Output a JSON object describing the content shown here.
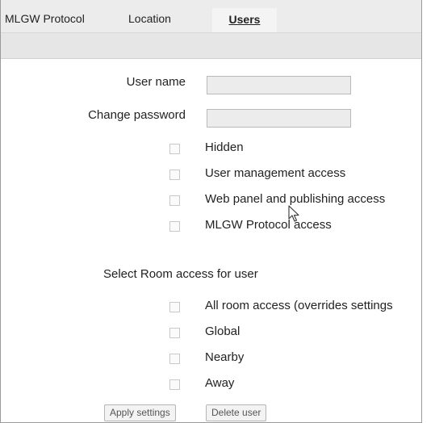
{
  "tabs": [
    {
      "label": "MLGW Protocol",
      "active": false
    },
    {
      "label": "Location",
      "active": false
    },
    {
      "label": "Users",
      "active": true
    }
  ],
  "form": {
    "user_name_label": "User name",
    "user_name_value": "",
    "change_password_label": "Change password",
    "change_password_value": ""
  },
  "permissions": [
    {
      "label": "Hidden",
      "checked": false
    },
    {
      "label": "User management access",
      "checked": false
    },
    {
      "label": "Web panel and publishing access",
      "checked": false
    },
    {
      "label": "MLGW Protocol access",
      "checked": false
    }
  ],
  "room_access": {
    "title": "Select Room access for user",
    "options": [
      {
        "label": "All room access (overrides settings",
        "checked": false
      },
      {
        "label": "Global",
        "checked": false
      },
      {
        "label": "Nearby",
        "checked": false
      },
      {
        "label": "Away",
        "checked": false
      }
    ]
  },
  "buttons": {
    "apply_label": "Apply settings",
    "delete_label": "Delete user"
  },
  "colors": {
    "tabbar_bg": "#ececec",
    "subbar_bg": "#e6e6e6",
    "input_bg": "#ececec"
  },
  "icons": {
    "cursor": "mouse-pointer-icon"
  }
}
